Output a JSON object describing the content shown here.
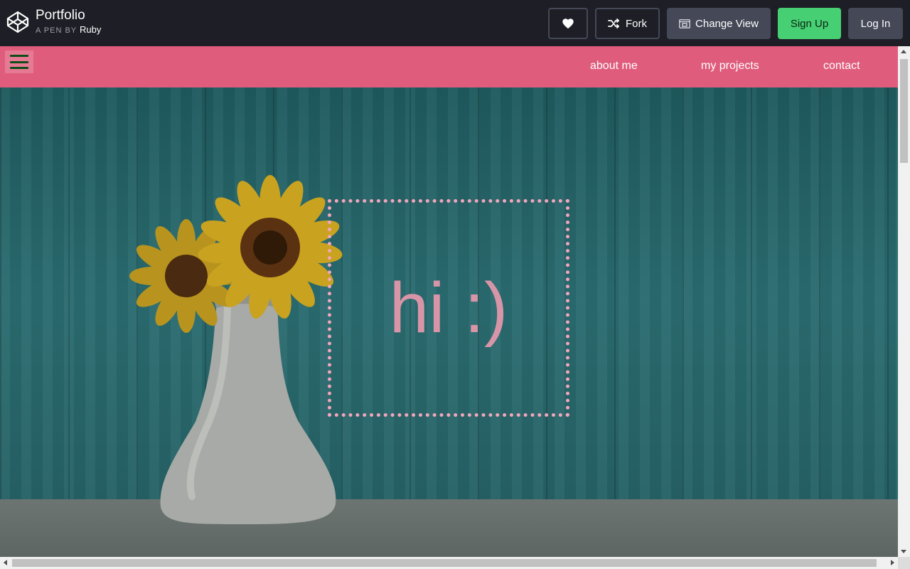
{
  "codepen": {
    "pen_title": "Portfolio",
    "pen_by_label": "A PEN BY",
    "author": "Ruby",
    "buttons": {
      "heart_icon": "heart-icon",
      "fork_label": "Fork",
      "change_view_label": "Change View",
      "sign_up_label": "Sign Up",
      "log_in_label": "Log In"
    },
    "colors": {
      "bar_bg": "#1e1f26",
      "button_gray": "#444857",
      "sign_up_green": "#47cf73"
    }
  },
  "site": {
    "nav": {
      "menu_icon": "hamburger-menu-icon",
      "links": [
        "about me",
        "my projects",
        "contact"
      ],
      "bg_color": "#e05c7c"
    },
    "hero": {
      "greeting": "hi :)",
      "box_border_color": "#f2a6bb",
      "text_color": "#d995a8",
      "background_image": "teal wooden wall with sunflowers in a white vase"
    }
  }
}
